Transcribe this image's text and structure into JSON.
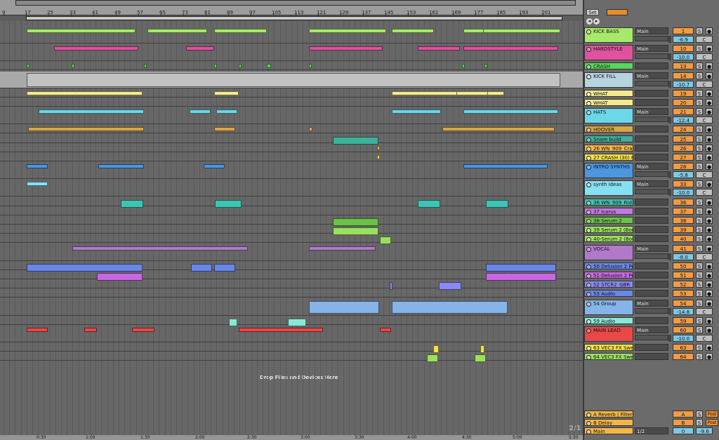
{
  "ruler": {
    "bars": [
      "9",
      "17",
      "25",
      "33",
      "41",
      "49",
      "57",
      "65",
      "73",
      "81",
      "89",
      "97",
      "105",
      "113",
      "121",
      "129",
      "137",
      "145",
      "153",
      "161",
      "169",
      "177",
      "185",
      "193",
      "201"
    ]
  },
  "time_ruler": [
    "0:30",
    "1:00",
    "1:30",
    "2:00",
    "2:30",
    "3:00",
    "3:30",
    "4:00",
    "4:30",
    "5:00",
    "5:30"
  ],
  "drop_hint": "Drop Files and Devices Here",
  "page_indicator": "2/1",
  "mixer": {
    "set_label": "Set",
    "tracks": [
      {
        "name": "KICK BASS",
        "color": "#a8e86a",
        "route": "Main",
        "num": "1",
        "vol": "-6.9",
        "c": "C",
        "s": "S",
        "h": 24
      },
      {
        "name": "HARDSTYLE",
        "color": "#e0529e",
        "route": "Main",
        "num": "10",
        "vol": "-10.0",
        "c": "C",
        "s": "S",
        "h": 24
      },
      {
        "name": "CRASH",
        "color": "#5ad65a",
        "route": "",
        "num": "13",
        "vol": "",
        "c": "",
        "s": "S",
        "h": 12
      },
      {
        "name": "KICK FILL",
        "color": "#b6d4e0",
        "route": "Main",
        "num": "14",
        "vol": "-10.7",
        "c": "C",
        "s": "S",
        "h": 24
      },
      {
        "name": "WHAT",
        "color": "#f4ea8c",
        "route": "",
        "num": "19",
        "vol": "",
        "c": "",
        "s": "S",
        "h": 12
      },
      {
        "name": "WHAT",
        "color": "#f4ea8c",
        "route": "",
        "num": "20",
        "vol": "",
        "c": "",
        "s": "S",
        "h": 12
      },
      {
        "name": "HATS",
        "color": "#6ad8e8",
        "route": "Main",
        "num": "21",
        "vol": "-12.4",
        "c": "C",
        "s": "S",
        "h": 24
      },
      {
        "name": "HOOVER",
        "color": "#d9a648",
        "route": "",
        "num": "24",
        "vol": "",
        "c": "",
        "s": "S",
        "h": 12
      },
      {
        "name": "Snare build",
        "color": "#40b09a",
        "route": "",
        "num": "25",
        "vol": "",
        "c": "",
        "s": "S",
        "h": 12
      },
      {
        "name": "26 WN_909_Cra",
        "color": "#f3b646",
        "route": "",
        "num": "26",
        "vol": "",
        "c": "",
        "s": "S",
        "h": 12
      },
      {
        "name": "27 CRASH (30) R",
        "color": "#f3e046",
        "route": "",
        "num": "27",
        "vol": "",
        "c": "",
        "s": "S",
        "h": 12
      },
      {
        "name": "INTRO SYNTHS",
        "color": "#4c96e0",
        "route": "Main",
        "num": "28",
        "vol": "-5.8",
        "c": "C",
        "s": "S",
        "h": 24
      },
      {
        "name": "synth ideas",
        "color": "#86e0f4",
        "route": "Main",
        "num": "33",
        "vol": "-10.0",
        "c": "C",
        "s": "S",
        "h": 24
      },
      {
        "name": "36 WN_909_Rid",
        "color": "#3fc4b4",
        "route": "",
        "num": "36",
        "vol": "",
        "c": "",
        "s": "S",
        "h": 12
      },
      {
        "name": "37 Icarus",
        "color": "#c07ae0",
        "route": "",
        "num": "37",
        "vol": "",
        "c": "",
        "s": "S",
        "h": 12
      },
      {
        "name": "38 Serum 2",
        "color": "#6ac246",
        "route": "",
        "num": "38",
        "vol": "",
        "c": "",
        "s": "S",
        "h": 12
      },
      {
        "name": "39 Serum 2 (Bou",
        "color": "#9ae060",
        "route": "",
        "num": "39",
        "vol": "",
        "c": "",
        "s": "S",
        "h": 12
      },
      {
        "name": "40-Serum 2 (Bou",
        "color": "#9ae060",
        "route": "",
        "num": "40",
        "vol": "",
        "c": "",
        "s": "S",
        "h": 12
      },
      {
        "name": "VOCAL",
        "color": "#b07ac8",
        "route": "Main",
        "num": "41",
        "vol": "-8.0",
        "c": "C",
        "s": "S",
        "h": 24
      },
      {
        "name": "50 Delusion 2 Pe",
        "color": "#6a86e8",
        "route": "",
        "num": "50",
        "vol": "",
        "c": "",
        "s": "S",
        "h": 12
      },
      {
        "name": "51 Delusion 2 Pe",
        "color": "#c868e0",
        "route": "",
        "num": "51",
        "vol": "",
        "c": "",
        "s": "S",
        "h": 12
      },
      {
        "name": "52 STCR2_GBR_",
        "color": "#8a8af4",
        "route": "",
        "num": "52",
        "vol": "",
        "c": "",
        "s": "S",
        "h": 12
      },
      {
        "name": "53 Audio",
        "color": "#6a86e8",
        "route": "",
        "num": "53",
        "vol": "",
        "c": "",
        "s": "S",
        "h": 12
      },
      {
        "name": "54 Group",
        "color": "#86b4e8",
        "route": "Main",
        "num": "54",
        "vol": "-14.8",
        "c": "C",
        "s": "S",
        "h": 24
      },
      {
        "name": "59 Audio",
        "color": "#8ae8d8",
        "route": "",
        "num": "59",
        "vol": "",
        "c": "",
        "s": "S",
        "h": 12
      },
      {
        "name": "MAIN LEAD",
        "color": "#e84848",
        "route": "Main",
        "num": "60",
        "vol": "-10.0",
        "c": "C",
        "s": "S",
        "h": 24
      },
      {
        "name": "63 VEC3 FX Swe",
        "color": "#f4e046",
        "route": "",
        "num": "63",
        "vol": "",
        "c": "",
        "s": "S",
        "h": 12
      },
      {
        "name": "64 VEC3 FX Swe",
        "color": "#9ae060",
        "route": "",
        "num": "64",
        "vol": "",
        "c": "",
        "s": "S",
        "h": 12
      }
    ],
    "returns": [
      {
        "name": "A Reverb | Filter",
        "num": "A",
        "s": "S",
        "post": "Post"
      },
      {
        "name": "B Delay",
        "num": "B",
        "s": "S",
        "post": "Post"
      },
      {
        "name": "Main",
        "num": "0",
        "route": "1/2",
        "vol": "-9.6"
      }
    ]
  }
}
